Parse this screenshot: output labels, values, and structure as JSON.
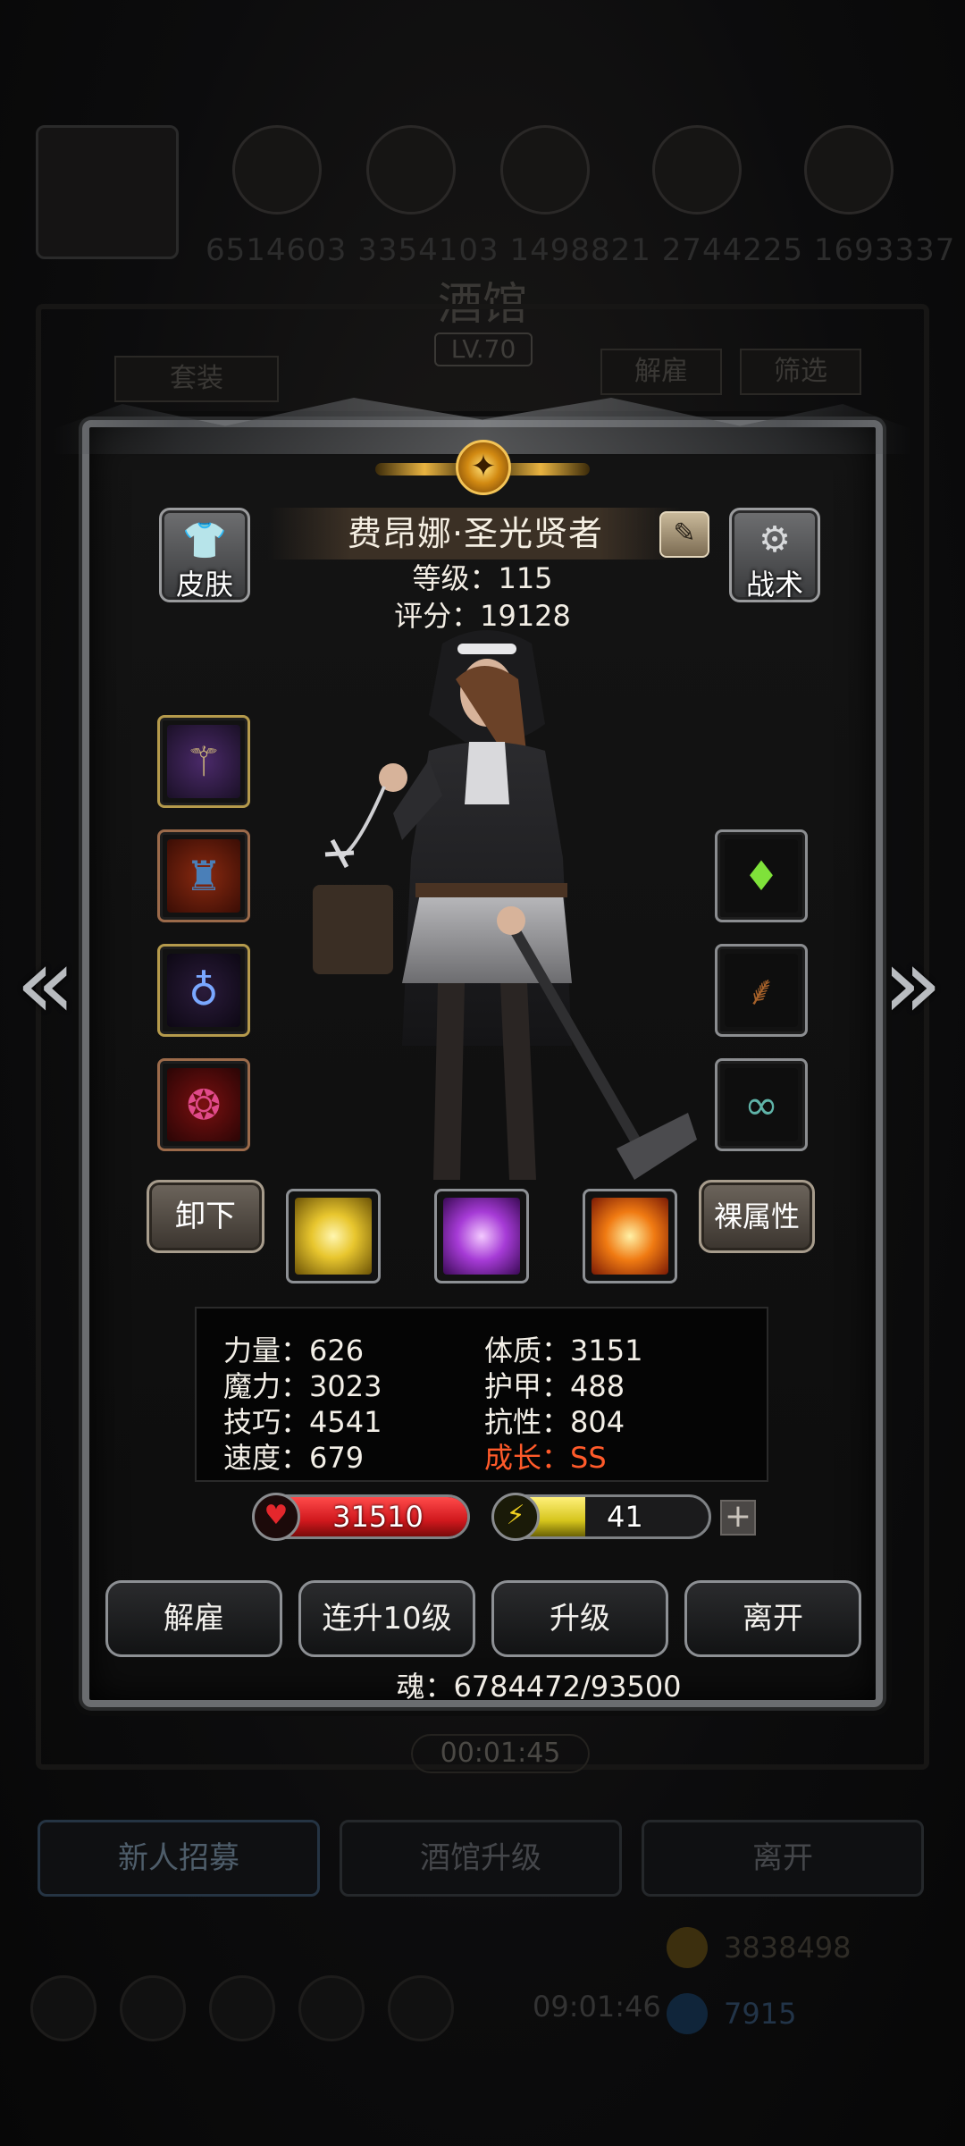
{
  "background": {
    "scores_text": "6514603  3354103  1498821  2744225  1693337",
    "tavern_title": "酒馆",
    "tavern_level": "LV.70",
    "tabs": {
      "suit": "套装",
      "dismiss": "解雇",
      "filter": "筛选"
    },
    "timer": "00:01:45",
    "bottom_buttons": {
      "recruit": "新人招募",
      "upgrade_tavern": "酒馆升级",
      "leave": "离开"
    },
    "resource_gold": "3838498",
    "resource_gem": "7915",
    "clock": "09:01:46"
  },
  "hero": {
    "name": "费昂娜·圣光贤者",
    "level_line": "等级：115",
    "score_line": "评分：19128"
  },
  "side_buttons": {
    "skin": "皮肤",
    "tactics": "战术"
  },
  "equipment": {
    "left": [
      {
        "name": "staff",
        "icon": "staff-icon",
        "glyph": "⚚"
      },
      {
        "name": "robe",
        "icon": "robe-icon",
        "glyph": "🧥"
      },
      {
        "name": "amulet",
        "icon": "amulet-icon",
        "glyph": "♁"
      },
      {
        "name": "orb",
        "icon": "orb-icon",
        "glyph": "❂"
      }
    ],
    "right": [
      {
        "name": "crystal",
        "icon": "crystal-icon",
        "glyph": "♦"
      },
      {
        "name": "pipe",
        "icon": "pipe-icon",
        "glyph": "⸙"
      },
      {
        "name": "goggles",
        "icon": "goggles-icon",
        "glyph": "∞"
      }
    ]
  },
  "skill_row": {
    "unequip": "卸下",
    "bare_attributes": "裸属性",
    "skills": [
      {
        "icon": "holy-burst-icon",
        "color": "#e8c62e"
      },
      {
        "icon": "arcane-rune-icon",
        "color": "#a63bd6"
      },
      {
        "icon": "flame-shield-icon",
        "color": "#f07a12"
      }
    ]
  },
  "attributes": {
    "strength": "力量：626",
    "constitution": "体质：3151",
    "magic": "魔力：3023",
    "armor": "护甲：488",
    "skill": "技巧：4541",
    "resistance": "抗性：804",
    "speed": "速度：679",
    "growth": "成长：SS"
  },
  "bars": {
    "hp": {
      "value": "31510",
      "color": "#d0181d",
      "fill_fraction": 1.0
    },
    "energy": {
      "value": "41",
      "color": "#d6c51c",
      "fill_fraction": 0.41
    }
  },
  "actions": {
    "dismiss": "解雇",
    "level_up_10": "连升10级",
    "level_up": "升级",
    "leave": "离开"
  },
  "soul": "魂：6784472/93500",
  "colors": {
    "growth": "#ff5a2a",
    "hp": "#d0181d",
    "energy": "#d6c51c",
    "emblem": "#e8b341"
  }
}
